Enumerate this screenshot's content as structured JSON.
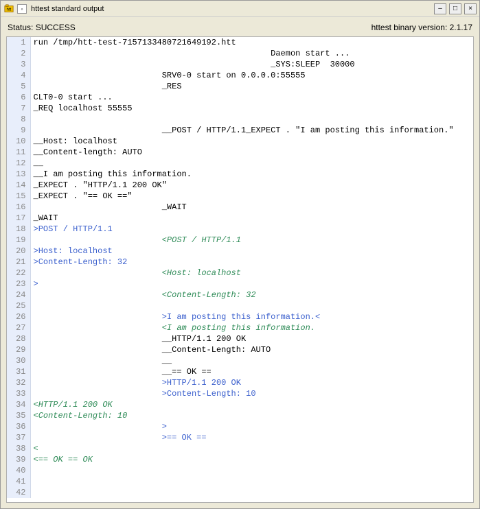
{
  "titlebar": {
    "title": "httest standard output",
    "pin_glyph": "◦",
    "min_glyph": "–",
    "max_glyph": "□",
    "close_glyph": "×"
  },
  "status": {
    "left_label": "Status:",
    "left_value": "SUCCESS",
    "right_label": "httest binary version:",
    "right_value": "2.1.17"
  },
  "code": {
    "lines": [
      {
        "n": 1,
        "s": [
          {
            "c": "default",
            "t": "run /tmp/htt-test-7157133480721649192.htt"
          }
        ]
      },
      {
        "n": 2,
        "s": [
          {
            "c": "default",
            "t": "                                                Daemon start ..."
          }
        ]
      },
      {
        "n": 3,
        "s": [
          {
            "c": "default",
            "t": "                                                _SYS:SLEEP  30000"
          }
        ]
      },
      {
        "n": 4,
        "s": [
          {
            "c": "default",
            "t": "                          SRV0-0 start on 0.0.0.0:55555"
          }
        ]
      },
      {
        "n": 5,
        "s": [
          {
            "c": "default",
            "t": "                          _RES"
          }
        ]
      },
      {
        "n": 6,
        "s": [
          {
            "c": "default",
            "t": "CLT0-0 start ..."
          }
        ]
      },
      {
        "n": 7,
        "s": [
          {
            "c": "default",
            "t": "_REQ localhost 55555"
          }
        ]
      },
      {
        "n": 8,
        "s": [
          {
            "c": "default",
            "t": ""
          }
        ]
      },
      {
        "n": 9,
        "s": [
          {
            "c": "default",
            "t": "                          __POST / HTTP/1.1_EXPECT . \"I am posting this information.\""
          }
        ]
      },
      {
        "n": 10,
        "s": [
          {
            "c": "default",
            "t": "__Host: localhost"
          }
        ]
      },
      {
        "n": 11,
        "s": [
          {
            "c": "default",
            "t": "__Content-length: AUTO"
          }
        ]
      },
      {
        "n": 12,
        "s": [
          {
            "c": "default",
            "t": "__"
          }
        ]
      },
      {
        "n": 13,
        "s": [
          {
            "c": "default",
            "t": "__I am posting this information."
          }
        ]
      },
      {
        "n": 14,
        "s": [
          {
            "c": "default",
            "t": "_EXPECT . \"HTTP/1.1 200 OK\""
          }
        ]
      },
      {
        "n": 15,
        "s": [
          {
            "c": "default",
            "t": "_EXPECT . \"== OK ==\""
          }
        ]
      },
      {
        "n": 16,
        "s": [
          {
            "c": "default",
            "t": "                          _WAIT"
          }
        ]
      },
      {
        "n": 17,
        "s": [
          {
            "c": "default",
            "t": "_WAIT"
          }
        ]
      },
      {
        "n": 18,
        "s": [
          {
            "c": "blue",
            "t": ">POST / HTTP/1.1"
          }
        ]
      },
      {
        "n": 19,
        "s": [
          {
            "c": "default",
            "t": "                          "
          },
          {
            "c": "green",
            "t": "<POST / HTTP/1.1"
          }
        ]
      },
      {
        "n": 20,
        "s": [
          {
            "c": "blue",
            "t": ">Host: localhost"
          }
        ]
      },
      {
        "n": 21,
        "s": [
          {
            "c": "blue",
            "t": ">Content-Length: 32"
          }
        ]
      },
      {
        "n": 22,
        "s": [
          {
            "c": "default",
            "t": "                          "
          },
          {
            "c": "green",
            "t": "<Host: localhost"
          }
        ]
      },
      {
        "n": 23,
        "s": [
          {
            "c": "blue",
            "t": ">"
          }
        ]
      },
      {
        "n": 24,
        "s": [
          {
            "c": "default",
            "t": "                          "
          },
          {
            "c": "green",
            "t": "<Content-Length: 32"
          }
        ]
      },
      {
        "n": 25,
        "s": [
          {
            "c": "default",
            "t": ""
          }
        ]
      },
      {
        "n": 26,
        "s": [
          {
            "c": "default",
            "t": "                          "
          },
          {
            "c": "blue",
            "t": ">I am posting this information.<"
          }
        ]
      },
      {
        "n": 27,
        "s": [
          {
            "c": "default",
            "t": "                          "
          },
          {
            "c": "green",
            "t": "<I am posting this information."
          }
        ]
      },
      {
        "n": 28,
        "s": [
          {
            "c": "default",
            "t": "                          __HTTP/1.1 200 OK"
          }
        ]
      },
      {
        "n": 29,
        "s": [
          {
            "c": "default",
            "t": "                          __Content-Length: AUTO"
          }
        ]
      },
      {
        "n": 30,
        "s": [
          {
            "c": "default",
            "t": "                          __"
          }
        ]
      },
      {
        "n": 31,
        "s": [
          {
            "c": "default",
            "t": "                          __== OK =="
          }
        ]
      },
      {
        "n": 32,
        "s": [
          {
            "c": "default",
            "t": "                          "
          },
          {
            "c": "blue",
            "t": ">HTTP/1.1 200 OK"
          }
        ]
      },
      {
        "n": 33,
        "s": [
          {
            "c": "default",
            "t": "                          "
          },
          {
            "c": "blue",
            "t": ">Content-Length: 10"
          }
        ]
      },
      {
        "n": 34,
        "s": [
          {
            "c": "green",
            "t": "<HTTP/1.1 200 OK"
          }
        ]
      },
      {
        "n": 35,
        "s": [
          {
            "c": "green",
            "t": "<Content-Length: 10"
          }
        ]
      },
      {
        "n": 36,
        "s": [
          {
            "c": "default",
            "t": "                          "
          },
          {
            "c": "blue",
            "t": ">"
          }
        ]
      },
      {
        "n": 37,
        "s": [
          {
            "c": "default",
            "t": "                          "
          },
          {
            "c": "blue",
            "t": ">== OK =="
          }
        ]
      },
      {
        "n": 38,
        "s": [
          {
            "c": "green",
            "t": "<"
          }
        ]
      },
      {
        "n": 39,
        "s": [
          {
            "c": "green",
            "t": "<== OK == OK"
          }
        ]
      },
      {
        "n": 40,
        "s": [
          {
            "c": "default",
            "t": ""
          }
        ]
      },
      {
        "n": 41,
        "s": [
          {
            "c": "default",
            "t": ""
          }
        ]
      },
      {
        "n": 42,
        "s": [
          {
            "c": "default",
            "t": ""
          }
        ]
      }
    ]
  }
}
